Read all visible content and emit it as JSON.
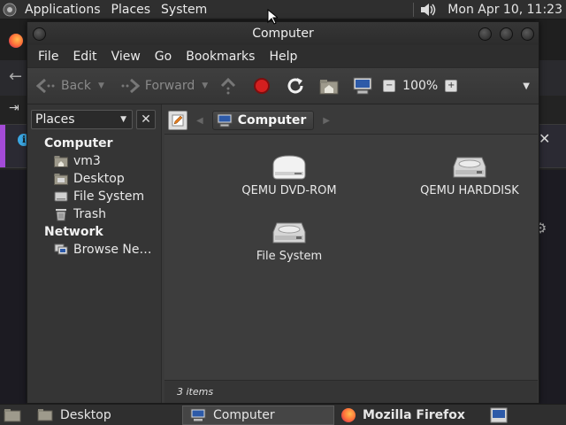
{
  "top_panel": {
    "menus": [
      "Applications",
      "Places",
      "System"
    ],
    "clock": "Mon Apr 10, 11:23"
  },
  "window": {
    "title": "Computer",
    "menubar": [
      "File",
      "Edit",
      "View",
      "Go",
      "Bookmarks",
      "Help"
    ],
    "toolbar": {
      "back_label": "Back",
      "forward_label": "Forward",
      "zoom_level": "100%"
    },
    "sidebar": {
      "selector_label": "Places",
      "sections": [
        {
          "title": "Computer",
          "items": [
            "vm3",
            "Desktop",
            "File System",
            "Trash"
          ]
        },
        {
          "title": "Network",
          "items": [
            "Browse Net…"
          ]
        }
      ]
    },
    "location": {
      "crumb": "Computer"
    },
    "files": [
      "QEMU DVD-ROM",
      "QEMU HARDDISK",
      "File System"
    ],
    "status": "3 items"
  },
  "bottom_panel": {
    "tasks": [
      "Desktop",
      "Computer",
      "Mozilla Firefox"
    ]
  },
  "colors": {
    "panel_bg": "#2f2f2f",
    "window_bg": "#3a3a3a",
    "content_bg": "#3d3d3d",
    "stop_red": "#d41f1f",
    "firefox_orange": "#ff7139"
  }
}
